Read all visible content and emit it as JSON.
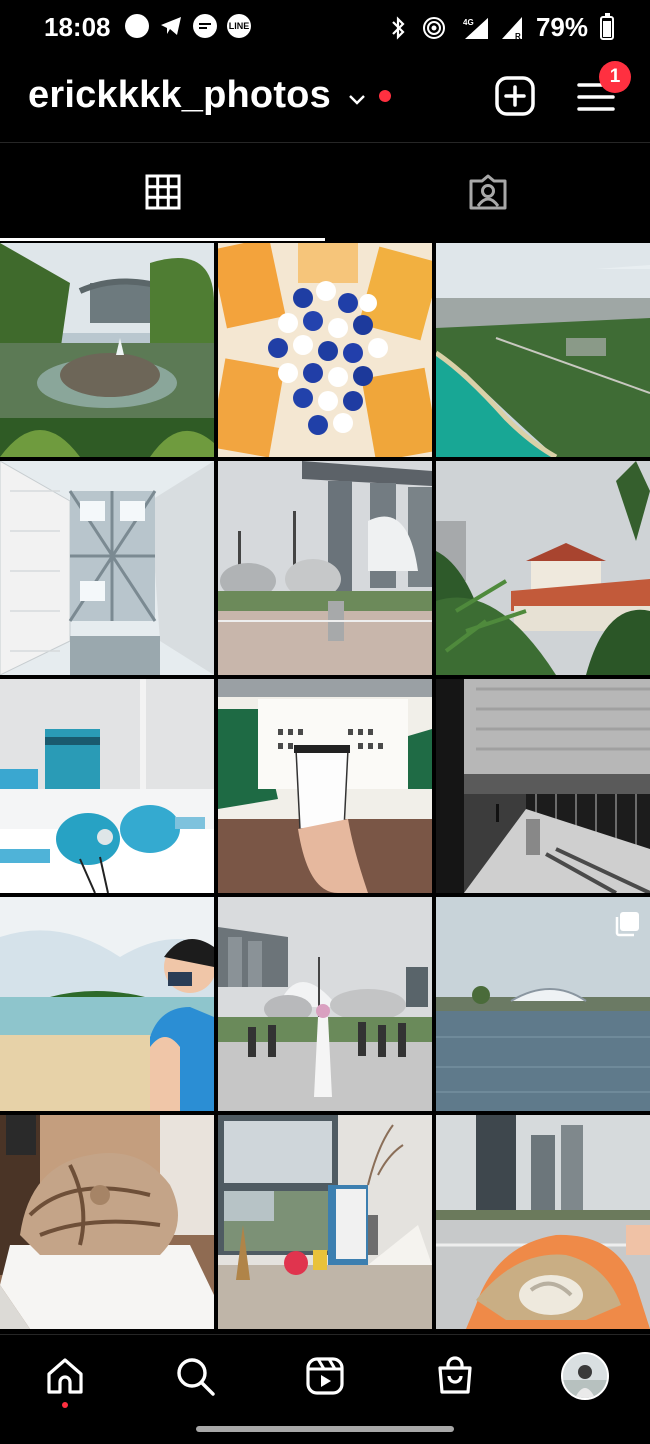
{
  "status_bar": {
    "time": "18:08",
    "apps": [
      "whatsapp-icon",
      "telegram-icon",
      "messages-icon",
      "line-icon"
    ],
    "line_label": "LINE",
    "battery_text": "79%",
    "battery_level": 0.79
  },
  "header": {
    "username": "erickkkk_photos",
    "notification_count": "1",
    "accent_color": "#ff3040"
  },
  "tabs": [
    {
      "name": "posts-grid",
      "icon": "grid-icon",
      "selected": true
    },
    {
      "name": "tagged",
      "icon": "tagged-person-icon",
      "selected": false
    }
  ],
  "grid": {
    "posts": [
      {
        "scene": "gardens-pond",
        "multi": false
      },
      {
        "scene": "bottle-caps",
        "multi": false
      },
      {
        "scene": "aerial-coast",
        "multi": false
      },
      {
        "scene": "atrium-skylight",
        "multi": false
      },
      {
        "scene": "marina-bay-sands",
        "multi": false
      },
      {
        "scene": "temple-palms",
        "multi": false
      },
      {
        "scene": "exhibition-bags",
        "multi": false
      },
      {
        "scene": "starbucks-cup",
        "multi": false
      },
      {
        "scene": "train-station",
        "multi": false
      },
      {
        "scene": "beach-person",
        "multi": false
      },
      {
        "scene": "art-science-crowd",
        "multi": false
      },
      {
        "scene": "stadium-water",
        "multi": true
      },
      {
        "scene": "sculpture",
        "multi": false
      },
      {
        "scene": "window-desk",
        "multi": false
      },
      {
        "scene": "food-rooftop",
        "multi": false
      }
    ]
  },
  "bottom_nav": {
    "items": [
      "home-icon",
      "search-icon",
      "reels-icon",
      "shop-icon",
      "profile-avatar"
    ]
  }
}
